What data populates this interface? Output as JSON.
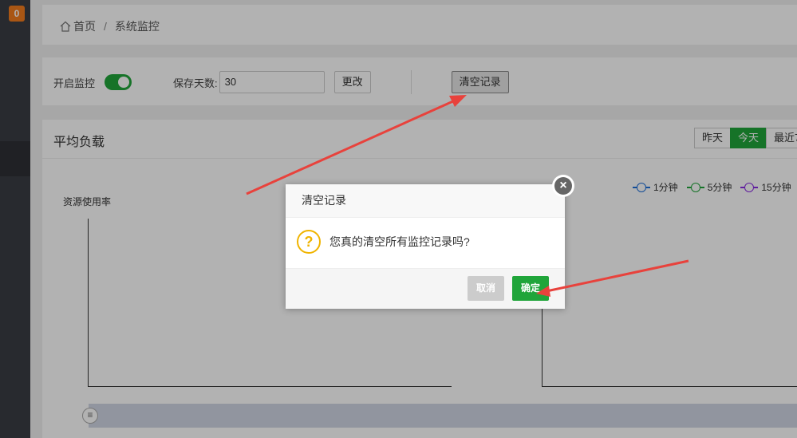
{
  "sidebar": {
    "badge": "0"
  },
  "breadcrumb": {
    "home": "首页",
    "separator": "/",
    "current": "系统监控"
  },
  "controls": {
    "monitor_label": "开启监控",
    "monitor_enabled": true,
    "keep_days_label": "保存天数:",
    "keep_days_value": "30",
    "change_button": "更改",
    "clear_button": "清空记录"
  },
  "chart": {
    "title": "平均负载",
    "tabs": [
      "昨天",
      "今天",
      "最近7"
    ],
    "active_tab": "今天",
    "axis_label": "资源使用率",
    "legend": [
      {
        "label": "1分钟",
        "color": "#1e6fd9"
      },
      {
        "label": "5分钟",
        "color": "#20a53a"
      },
      {
        "label": "15分钟",
        "color": "#8a2be2"
      }
    ]
  },
  "dialog": {
    "title": "清空记录",
    "message": "您真的清空所有监控记录吗?",
    "cancel": "取消",
    "confirm": "确定"
  },
  "colors": {
    "accent": "#20a53a",
    "badge": "#f37b1d",
    "arrow": "#e8423c"
  }
}
